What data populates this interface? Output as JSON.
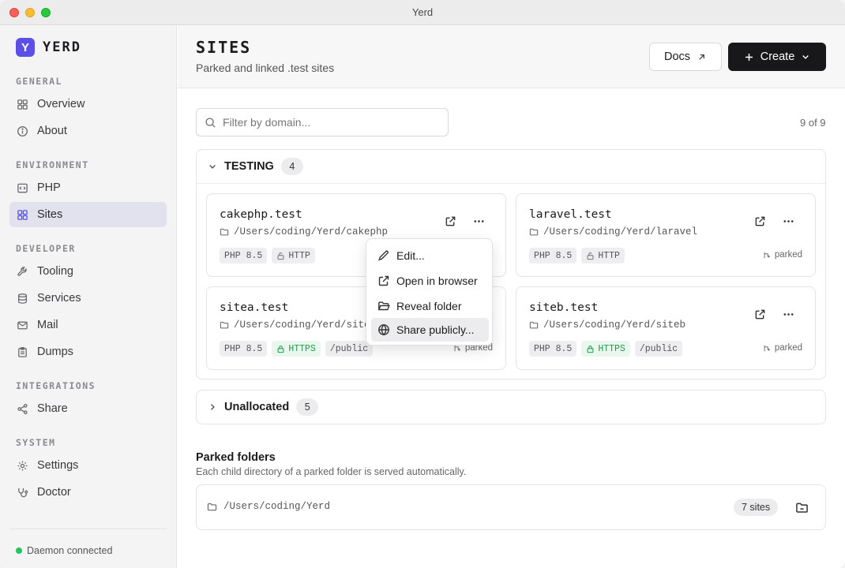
{
  "window": {
    "title": "Yerd"
  },
  "brand": {
    "logo_letter": "Y",
    "name": "YERD",
    "accent": "#5b4fe6"
  },
  "sidebar": {
    "groups": [
      {
        "label": "GENERAL",
        "items": [
          {
            "label": "Overview",
            "icon": "grid-icon"
          },
          {
            "label": "About",
            "icon": "info-icon"
          }
        ]
      },
      {
        "label": "ENVIRONMENT",
        "items": [
          {
            "label": "PHP",
            "icon": "code-icon"
          },
          {
            "label": "Sites",
            "icon": "grid-icon",
            "active": true
          }
        ]
      },
      {
        "label": "DEVELOPER",
        "items": [
          {
            "label": "Tooling",
            "icon": "wrench-icon"
          },
          {
            "label": "Services",
            "icon": "database-icon"
          },
          {
            "label": "Mail",
            "icon": "mail-icon"
          },
          {
            "label": "Dumps",
            "icon": "clipboard-icon"
          }
        ]
      },
      {
        "label": "INTEGRATIONS",
        "items": [
          {
            "label": "Share",
            "icon": "share-icon"
          }
        ]
      },
      {
        "label": "SYSTEM",
        "items": [
          {
            "label": "Settings",
            "icon": "gear-icon"
          },
          {
            "label": "Doctor",
            "icon": "stethoscope-icon"
          }
        ]
      }
    ],
    "status": {
      "label": "Daemon connected",
      "color": "#22c55e"
    }
  },
  "header": {
    "title": "SITES",
    "subtitle": "Parked and linked .test sites",
    "docs_label": "Docs",
    "create_label": "Create"
  },
  "filter": {
    "placeholder": "Filter by domain...",
    "value": ""
  },
  "count_label": "9 of 9",
  "groups": [
    {
      "name": "TESTING",
      "count": "4",
      "expanded": true,
      "sites": [
        {
          "domain": "cakephp.test",
          "path": "/Users/coding/Yerd/cakephp",
          "php": "PHP 8.5",
          "proto": "HTTP",
          "secure": false,
          "public": "",
          "parked": "parked"
        },
        {
          "domain": "laravel.test",
          "path": "/Users/coding/Yerd/laravel",
          "php": "PHP 8.5",
          "proto": "HTTP",
          "secure": false,
          "public": "",
          "parked": "parked"
        },
        {
          "domain": "sitea.test",
          "path": "/Users/coding/Yerd/sitea",
          "php": "PHP 8.5",
          "proto": "HTTPS",
          "secure": true,
          "public": "/public",
          "parked": "parked"
        },
        {
          "domain": "siteb.test",
          "path": "/Users/coding/Yerd/siteb",
          "php": "PHP 8.5",
          "proto": "HTTPS",
          "secure": true,
          "public": "/public",
          "parked": "parked"
        }
      ]
    },
    {
      "name": "Unallocated",
      "count": "5",
      "expanded": false
    }
  ],
  "context_menu": {
    "items": [
      {
        "label": "Edit...",
        "icon": "pencil-icon"
      },
      {
        "label": "Open in browser",
        "icon": "external-link-icon"
      },
      {
        "label": "Reveal folder",
        "icon": "folder-open-icon"
      },
      {
        "label": "Share publicly...",
        "icon": "globe-icon",
        "hover": true
      }
    ]
  },
  "parked_folders": {
    "title": "Parked folders",
    "subtitle": "Each child directory of a parked folder is served automatically.",
    "items": [
      {
        "path": "/Users/coding/Yerd",
        "count": "7 sites"
      }
    ]
  }
}
